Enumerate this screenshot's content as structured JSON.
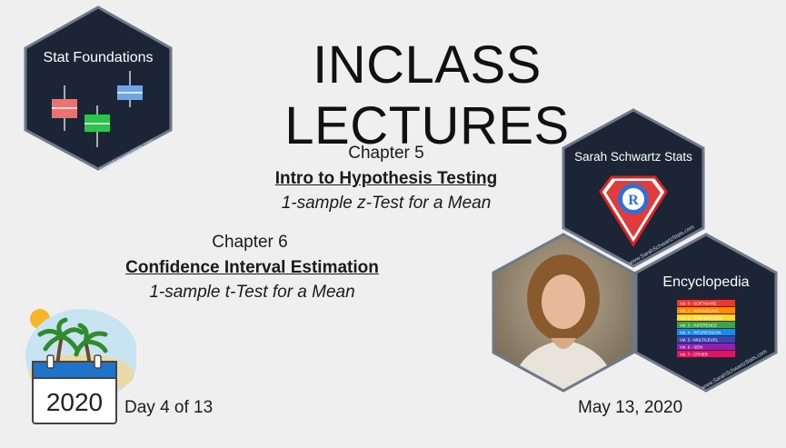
{
  "title": "INCLASS LECTURES",
  "logo_stat": {
    "label": "Stat Foundations",
    "url": "www.SarahSchwartzStats.com"
  },
  "logo_sss": {
    "label": "Sarah Schwartz Stats",
    "url": "www.SarahSchwartzStats.com"
  },
  "logo_encyclopedia": {
    "label": "Encyclopedia",
    "url": "www.SarahSchwartzStats.com",
    "volumes": [
      "Vol. 0 - SOFTWARE",
      "Vol. 1 - WRANGLING",
      "Vol. 2 - EXPLORATION",
      "Vol. 3 - INFERENCE",
      "Vol. 4 - REGRESSION",
      "Vol. 5 - MULTILEVEL",
      "Vol. 6 - SEM",
      "Vol. 7 - OTHER"
    ],
    "volume_colors": [
      "#e53935",
      "#fb8c00",
      "#fdd835",
      "#43a047",
      "#1e88e5",
      "#3949ab",
      "#8e24aa",
      "#d81b60"
    ]
  },
  "chapter5": {
    "chapter": "Chapter 5",
    "topic": "Intro to Hypothesis Testing",
    "test": "1-sample z-Test for a Mean"
  },
  "chapter6": {
    "chapter": "Chapter 6",
    "topic": "Confidence Interval Estimation",
    "test": "1-sample t-Test for a Mean"
  },
  "calendar": {
    "year": "2020"
  },
  "day_text": "Day 4 of 13",
  "date_text": "May 13, 2020",
  "colors": {
    "hex_bg": "#1b2536",
    "hex_border": "#6f7a89",
    "box_red": "#f07070",
    "box_green": "#2ec34f",
    "box_blue": "#6ea5e8"
  }
}
